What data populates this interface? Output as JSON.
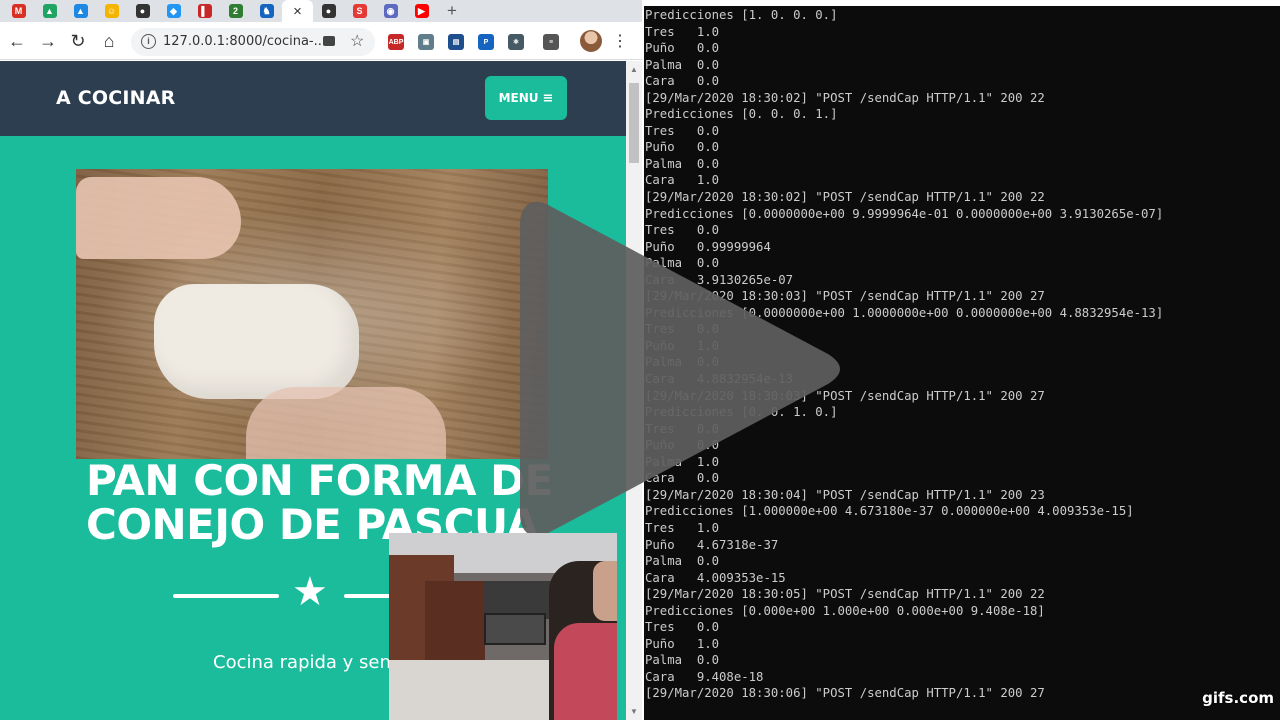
{
  "browser": {
    "tabs": [
      {
        "icon": "gmail-icon",
        "color": "#d93025",
        "glyph": "M"
      },
      {
        "icon": "drive-icon",
        "color": "#1fa463",
        "glyph": "▲"
      },
      {
        "icon": "drive-icon",
        "color": "#1e88e5",
        "glyph": "▲"
      },
      {
        "icon": "emoji-icon",
        "color": "#f4b400",
        "glyph": "☺"
      },
      {
        "icon": "globe-icon",
        "color": "#333333",
        "glyph": "●"
      },
      {
        "icon": "app-icon",
        "color": "#2196f3",
        "glyph": "◆"
      },
      {
        "icon": "bookmark-icon",
        "color": "#c62828",
        "glyph": "▌"
      },
      {
        "icon": "number-icon",
        "color": "#2e7d32",
        "glyph": "2"
      },
      {
        "icon": "app-icon",
        "color": "#1565c0",
        "glyph": "♞"
      }
    ],
    "active_tab_close": "×",
    "tabs_after": [
      {
        "icon": "globe-icon",
        "color": "#333333",
        "glyph": "●"
      },
      {
        "icon": "s-icon",
        "color": "#e53935",
        "glyph": "S"
      },
      {
        "icon": "app-icon",
        "color": "#5c6bc0",
        "glyph": "◉"
      },
      {
        "icon": "youtube-icon",
        "color": "#ff0000",
        "glyph": "▶"
      }
    ],
    "new_tab": "+",
    "url": "127.0.0.1:8000/cocina-...",
    "info_glyph": "i",
    "extensions": [
      {
        "icon": "abp-icon",
        "color": "#c62828",
        "label": "ABP"
      },
      {
        "icon": "cube-icon",
        "color": "#607d8b",
        "label": "▣"
      },
      {
        "icon": "extension-icon",
        "color": "#1e4e8c",
        "label": "▤"
      },
      {
        "icon": "extension-icon",
        "color": "#1565c0",
        "label": "P"
      },
      {
        "icon": "react-icon",
        "color": "#455a64",
        "label": "⚛"
      },
      {
        "icon": "playlist-icon",
        "color": "#555555",
        "label": "≡"
      }
    ]
  },
  "site": {
    "brand": "A COCINAR",
    "menu_label": "MENU",
    "menu_icon": "≡",
    "title": "PAN CON FORMA DE CONEJO DE PASCUA",
    "subtitle": "Cocina rapida y sencilla",
    "accent_color": "#1abc9c",
    "nav_color": "#2c3e50"
  },
  "terminal": {
    "lines": [
      "Predicciones [1. 0. 0. 0.]",
      "Tres   1.0",
      "Puño   0.0",
      "Palma  0.0",
      "Cara   0.0",
      "[29/Mar/2020 18:30:02] \"POST /sendCap HTTP/1.1\" 200 22",
      "Predicciones [0. 0. 0. 1.]",
      "Tres   0.0",
      "Puño   0.0",
      "Palma  0.0",
      "Cara   1.0",
      "[29/Mar/2020 18:30:02] \"POST /sendCap HTTP/1.1\" 200 22",
      "Predicciones [0.0000000e+00 9.9999964e-01 0.0000000e+00 3.9130265e-07]",
      "Tres   0.0",
      "Puño   0.99999964",
      "Palma  0.0",
      "Cara   3.9130265e-07",
      "[29/Mar/2020 18:30:03] \"POST /sendCap HTTP/1.1\" 200 27",
      "Predicciones [0.0000000e+00 1.0000000e+00 0.0000000e+00 4.8832954e-13]",
      "Tres   0.0",
      "Puño   1.0",
      "Palma  0.0",
      "Cara   4.8832954e-13",
      "[29/Mar/2020 18:30:03] \"POST /sendCap HTTP/1.1\" 200 27",
      "Predicciones [0. 0. 1. 0.]",
      "Tres   0.0",
      "Puño   0.0",
      "Palma  1.0",
      "Cara   0.0",
      "[29/Mar/2020 18:30:04] \"POST /sendCap HTTP/1.1\" 200 23",
      "Predicciones [1.000000e+00 4.673180e-37 0.000000e+00 4.009353e-15]",
      "Tres   1.0",
      "Puño   4.67318e-37",
      "Palma  0.0",
      "Cara   4.009353e-15",
      "[29/Mar/2020 18:30:05] \"POST /sendCap HTTP/1.1\" 200 22",
      "Predicciones [0.000e+00 1.000e+00 0.000e+00 9.408e-18]",
      "Tres   0.0",
      "Puño   1.0",
      "Palma  0.0",
      "Cara   9.408e-18",
      "[29/Mar/2020 18:30:06] \"POST /sendCap HTTP/1.1\" 200 27"
    ]
  },
  "watermark": "gifs.com"
}
